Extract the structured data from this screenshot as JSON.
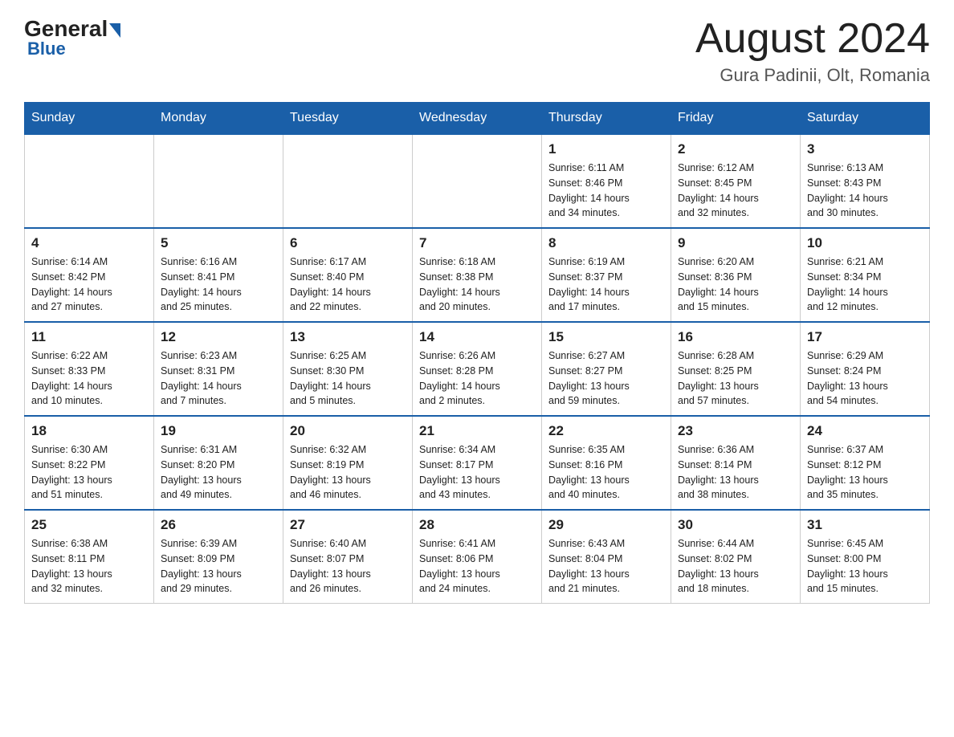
{
  "logo": {
    "general": "General",
    "blue": "Blue"
  },
  "header": {
    "month_year": "August 2024",
    "location": "Gura Padinii, Olt, Romania"
  },
  "weekdays": [
    "Sunday",
    "Monday",
    "Tuesday",
    "Wednesday",
    "Thursday",
    "Friday",
    "Saturday"
  ],
  "weeks": [
    [
      {
        "day": "",
        "info": ""
      },
      {
        "day": "",
        "info": ""
      },
      {
        "day": "",
        "info": ""
      },
      {
        "day": "",
        "info": ""
      },
      {
        "day": "1",
        "info": "Sunrise: 6:11 AM\nSunset: 8:46 PM\nDaylight: 14 hours\nand 34 minutes."
      },
      {
        "day": "2",
        "info": "Sunrise: 6:12 AM\nSunset: 8:45 PM\nDaylight: 14 hours\nand 32 minutes."
      },
      {
        "day": "3",
        "info": "Sunrise: 6:13 AM\nSunset: 8:43 PM\nDaylight: 14 hours\nand 30 minutes."
      }
    ],
    [
      {
        "day": "4",
        "info": "Sunrise: 6:14 AM\nSunset: 8:42 PM\nDaylight: 14 hours\nand 27 minutes."
      },
      {
        "day": "5",
        "info": "Sunrise: 6:16 AM\nSunset: 8:41 PM\nDaylight: 14 hours\nand 25 minutes."
      },
      {
        "day": "6",
        "info": "Sunrise: 6:17 AM\nSunset: 8:40 PM\nDaylight: 14 hours\nand 22 minutes."
      },
      {
        "day": "7",
        "info": "Sunrise: 6:18 AM\nSunset: 8:38 PM\nDaylight: 14 hours\nand 20 minutes."
      },
      {
        "day": "8",
        "info": "Sunrise: 6:19 AM\nSunset: 8:37 PM\nDaylight: 14 hours\nand 17 minutes."
      },
      {
        "day": "9",
        "info": "Sunrise: 6:20 AM\nSunset: 8:36 PM\nDaylight: 14 hours\nand 15 minutes."
      },
      {
        "day": "10",
        "info": "Sunrise: 6:21 AM\nSunset: 8:34 PM\nDaylight: 14 hours\nand 12 minutes."
      }
    ],
    [
      {
        "day": "11",
        "info": "Sunrise: 6:22 AM\nSunset: 8:33 PM\nDaylight: 14 hours\nand 10 minutes."
      },
      {
        "day": "12",
        "info": "Sunrise: 6:23 AM\nSunset: 8:31 PM\nDaylight: 14 hours\nand 7 minutes."
      },
      {
        "day": "13",
        "info": "Sunrise: 6:25 AM\nSunset: 8:30 PM\nDaylight: 14 hours\nand 5 minutes."
      },
      {
        "day": "14",
        "info": "Sunrise: 6:26 AM\nSunset: 8:28 PM\nDaylight: 14 hours\nand 2 minutes."
      },
      {
        "day": "15",
        "info": "Sunrise: 6:27 AM\nSunset: 8:27 PM\nDaylight: 13 hours\nand 59 minutes."
      },
      {
        "day": "16",
        "info": "Sunrise: 6:28 AM\nSunset: 8:25 PM\nDaylight: 13 hours\nand 57 minutes."
      },
      {
        "day": "17",
        "info": "Sunrise: 6:29 AM\nSunset: 8:24 PM\nDaylight: 13 hours\nand 54 minutes."
      }
    ],
    [
      {
        "day": "18",
        "info": "Sunrise: 6:30 AM\nSunset: 8:22 PM\nDaylight: 13 hours\nand 51 minutes."
      },
      {
        "day": "19",
        "info": "Sunrise: 6:31 AM\nSunset: 8:20 PM\nDaylight: 13 hours\nand 49 minutes."
      },
      {
        "day": "20",
        "info": "Sunrise: 6:32 AM\nSunset: 8:19 PM\nDaylight: 13 hours\nand 46 minutes."
      },
      {
        "day": "21",
        "info": "Sunrise: 6:34 AM\nSunset: 8:17 PM\nDaylight: 13 hours\nand 43 minutes."
      },
      {
        "day": "22",
        "info": "Sunrise: 6:35 AM\nSunset: 8:16 PM\nDaylight: 13 hours\nand 40 minutes."
      },
      {
        "day": "23",
        "info": "Sunrise: 6:36 AM\nSunset: 8:14 PM\nDaylight: 13 hours\nand 38 minutes."
      },
      {
        "day": "24",
        "info": "Sunrise: 6:37 AM\nSunset: 8:12 PM\nDaylight: 13 hours\nand 35 minutes."
      }
    ],
    [
      {
        "day": "25",
        "info": "Sunrise: 6:38 AM\nSunset: 8:11 PM\nDaylight: 13 hours\nand 32 minutes."
      },
      {
        "day": "26",
        "info": "Sunrise: 6:39 AM\nSunset: 8:09 PM\nDaylight: 13 hours\nand 29 minutes."
      },
      {
        "day": "27",
        "info": "Sunrise: 6:40 AM\nSunset: 8:07 PM\nDaylight: 13 hours\nand 26 minutes."
      },
      {
        "day": "28",
        "info": "Sunrise: 6:41 AM\nSunset: 8:06 PM\nDaylight: 13 hours\nand 24 minutes."
      },
      {
        "day": "29",
        "info": "Sunrise: 6:43 AM\nSunset: 8:04 PM\nDaylight: 13 hours\nand 21 minutes."
      },
      {
        "day": "30",
        "info": "Sunrise: 6:44 AM\nSunset: 8:02 PM\nDaylight: 13 hours\nand 18 minutes."
      },
      {
        "day": "31",
        "info": "Sunrise: 6:45 AM\nSunset: 8:00 PM\nDaylight: 13 hours\nand 15 minutes."
      }
    ]
  ]
}
